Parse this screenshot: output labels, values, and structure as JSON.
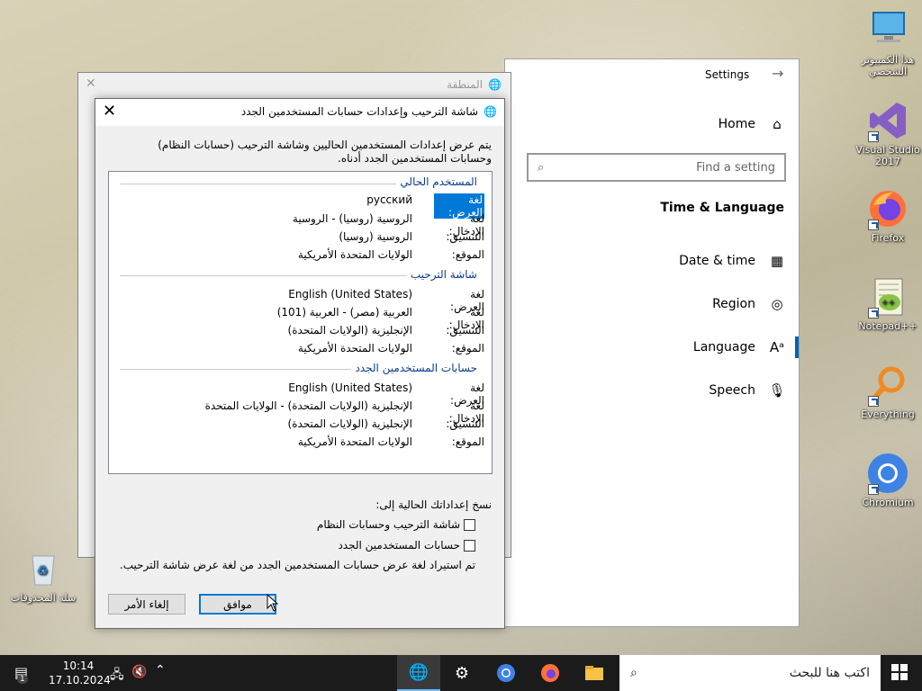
{
  "desktop": {
    "icons": [
      {
        "label": "هذا الكمبيوتر الشخصي",
        "icon": "computer-icon"
      },
      {
        "label": "Visual Studio 2017",
        "icon": "visual-studio-icon"
      },
      {
        "label": "Firefox",
        "icon": "firefox-icon"
      },
      {
        "label": "Notepad++",
        "icon": "notepadpp-icon"
      },
      {
        "label": "Everything",
        "icon": "everything-search-icon"
      },
      {
        "label": "Chromium",
        "icon": "chromium-icon"
      },
      {
        "label": "سلة المحذوفات",
        "icon": "recycle-bin-icon"
      }
    ]
  },
  "settings": {
    "title": "Settings",
    "home": "Home",
    "search_placeholder": "Find a setting",
    "section": "Time & Language",
    "items": [
      "Date & time",
      "Region",
      "Language",
      "Speech"
    ],
    "active_item": "Language"
  },
  "region_window": {
    "title": "المنطقة"
  },
  "dialog": {
    "title": "شاشة الترحيب وإعدادات حسابات المستخدمين الجدد",
    "intro": "يتم عرض إعدادات المستخدمين الحاليين وشاشة الترحيب (حسابات النظام) وحسابات المستخدمين الجدد أدناه.",
    "groups": [
      {
        "heading": "المستخدم الحالي",
        "rows": [
          {
            "label": "لغة العرض:",
            "value": "русский"
          },
          {
            "label": "لغة الإدخال:",
            "value": "الروسية (روسيا) - الروسية"
          },
          {
            "label": "التنسيق:",
            "value": "الروسية (روسيا)"
          },
          {
            "label": "الموقع:",
            "value": "الولايات المتحدة الأمريكية"
          }
        ]
      },
      {
        "heading": "شاشة الترحيب",
        "rows": [
          {
            "label": "لغة العرض:",
            "value": "English (United States)"
          },
          {
            "label": "لغة الإدخال:",
            "value": "العربية (مصر) - العربية (101)"
          },
          {
            "label": "التنسيق:",
            "value": "الإنجليزية (الولايات المتحدة)"
          },
          {
            "label": "الموقع:",
            "value": "الولايات المتحدة الأمريكية"
          }
        ]
      },
      {
        "heading": "حسابات المستخدمين الجدد",
        "rows": [
          {
            "label": "لغة العرض:",
            "value": "English (United States)"
          },
          {
            "label": "لغة الإدخال:",
            "value": "الإنجليزية (الولايات المتحدة) - الولايات المتحدة"
          },
          {
            "label": "التنسيق:",
            "value": "الإنجليزية (الولايات المتحدة)"
          },
          {
            "label": "الموقع:",
            "value": "الولايات المتحدة الأمريكية"
          }
        ]
      }
    ],
    "copy_title": "نسخ إعداداتك الحالية إلى:",
    "checkbox_welcome": "شاشة الترحيب وحسابات النظام",
    "checkbox_new_users": "حسابات المستخدمين الجدد",
    "note": "تم استيراد لغة عرض حسابات المستخدمين الجدد من لغة عرض شاشة الترحيب.",
    "ok": "موافق",
    "cancel": "إلغاء الأمر"
  },
  "taskbar": {
    "search_placeholder": "اكتب هنا للبحث",
    "time": "10:14",
    "date": "17.10.2024",
    "notification_count": "1"
  }
}
